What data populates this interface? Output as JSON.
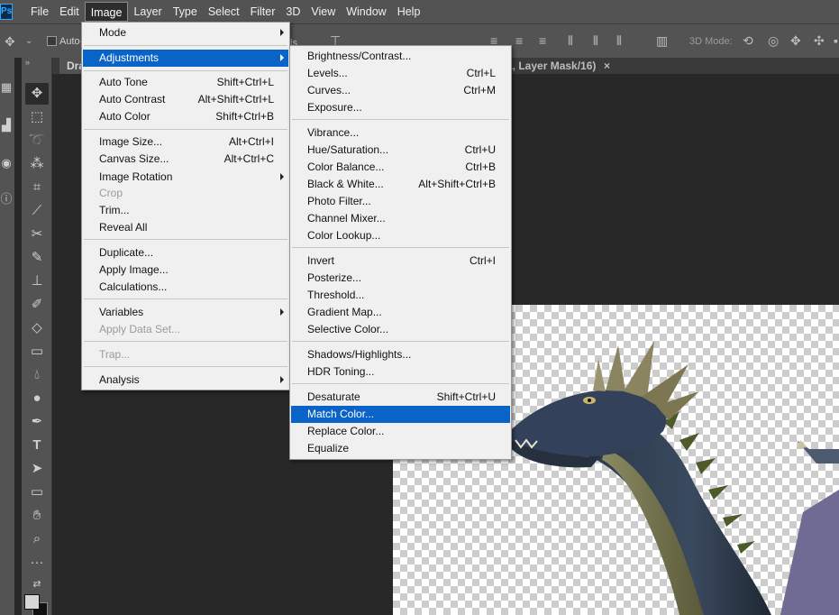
{
  "app": {
    "logo_text": "Ps",
    "menubar": [
      "File",
      "Edit",
      "Image",
      "Layer",
      "Type",
      "Select",
      "Filter",
      "3D",
      "View",
      "Window",
      "Help"
    ],
    "active_menu": "Image"
  },
  "options_bar": {
    "auto_select_label": "Auto-",
    "overlap_label": "ls",
    "mode_3d_label": "3D Mode:"
  },
  "document": {
    "tab_title_left": "Dra",
    "tab_title_right": "a, Layer Mask/16)",
    "close_glyph": "×"
  },
  "image_menu": {
    "items": [
      {
        "label": "Mode",
        "shortcut": "",
        "submenu": true,
        "disabled": false
      },
      {
        "label": "Adjustments",
        "shortcut": "",
        "submenu": true,
        "disabled": false,
        "highlighted": true
      },
      {
        "label": "Auto Tone",
        "shortcut": "Shift+Ctrl+L"
      },
      {
        "label": "Auto Contrast",
        "shortcut": "Alt+Shift+Ctrl+L"
      },
      {
        "label": "Auto Color",
        "shortcut": "Shift+Ctrl+B"
      },
      {
        "label": "Image Size...",
        "shortcut": "Alt+Ctrl+I"
      },
      {
        "label": "Canvas Size...",
        "shortcut": "Alt+Ctrl+C"
      },
      {
        "label": "Image Rotation",
        "shortcut": "",
        "submenu": true
      },
      {
        "label": "Crop",
        "shortcut": "",
        "disabled": true
      },
      {
        "label": "Trim...",
        "shortcut": ""
      },
      {
        "label": "Reveal All",
        "shortcut": ""
      },
      {
        "label": "Duplicate...",
        "shortcut": ""
      },
      {
        "label": "Apply Image...",
        "shortcut": ""
      },
      {
        "label": "Calculations...",
        "shortcut": ""
      },
      {
        "label": "Variables",
        "shortcut": "",
        "submenu": true
      },
      {
        "label": "Apply Data Set...",
        "shortcut": "",
        "disabled": true
      },
      {
        "label": "Trap...",
        "shortcut": "",
        "disabled": true
      },
      {
        "label": "Analysis",
        "shortcut": "",
        "submenu": true
      }
    ]
  },
  "adjustments_menu": {
    "items": [
      {
        "label": "Brightness/Contrast...",
        "shortcut": ""
      },
      {
        "label": "Levels...",
        "shortcut": "Ctrl+L"
      },
      {
        "label": "Curves...",
        "shortcut": "Ctrl+M"
      },
      {
        "label": "Exposure...",
        "shortcut": ""
      },
      {
        "label": "Vibrance...",
        "shortcut": ""
      },
      {
        "label": "Hue/Saturation...",
        "shortcut": "Ctrl+U"
      },
      {
        "label": "Color Balance...",
        "shortcut": "Ctrl+B"
      },
      {
        "label": "Black & White...",
        "shortcut": "Alt+Shift+Ctrl+B"
      },
      {
        "label": "Photo Filter...",
        "shortcut": ""
      },
      {
        "label": "Channel Mixer...",
        "shortcut": ""
      },
      {
        "label": "Color Lookup...",
        "shortcut": ""
      },
      {
        "label": "Invert",
        "shortcut": "Ctrl+I"
      },
      {
        "label": "Posterize...",
        "shortcut": ""
      },
      {
        "label": "Threshold...",
        "shortcut": ""
      },
      {
        "label": "Gradient Map...",
        "shortcut": ""
      },
      {
        "label": "Selective Color...",
        "shortcut": ""
      },
      {
        "label": "Shadows/Highlights...",
        "shortcut": ""
      },
      {
        "label": "HDR Toning...",
        "shortcut": ""
      },
      {
        "label": "Desaturate",
        "shortcut": "Shift+Ctrl+U"
      },
      {
        "label": "Match Color...",
        "shortcut": "",
        "highlighted": true
      },
      {
        "label": "Replace Color...",
        "shortcut": ""
      },
      {
        "label": "Equalize",
        "shortcut": ""
      }
    ]
  },
  "tools": [
    "move-tool",
    "marquee-tool",
    "lasso-tool",
    "magic-wand-tool",
    "crop-tool",
    "eyedropper-tool",
    "healing-tool",
    "brush-tool",
    "stamp-tool",
    "history-brush-tool",
    "eraser-tool",
    "gradient-tool",
    "blur-tool",
    "dodge-tool",
    "pen-tool",
    "type-tool",
    "path-selection-tool",
    "rectangle-tool",
    "hand-tool",
    "zoom-tool",
    "more-tools"
  ],
  "colors": {
    "menu_highlight": "#0a64c8",
    "foreground": "#d6d6d6",
    "background": "#111111"
  }
}
